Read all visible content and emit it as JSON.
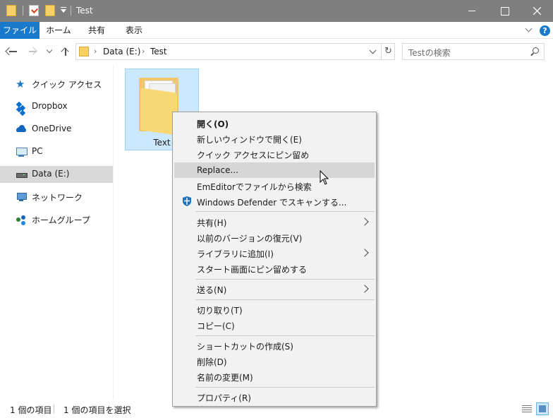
{
  "window": {
    "title": "Test"
  },
  "ribbon": {
    "tabs": [
      "ファイル",
      "ホーム",
      "共有",
      "表示"
    ]
  },
  "address": {
    "segments": [
      "Data (E:)",
      "Test"
    ],
    "search_placeholder": "Testの検索"
  },
  "navpane": {
    "items": [
      {
        "label": "クイック アクセス",
        "icon": "star-icon",
        "selected": false
      },
      {
        "label": "Dropbox",
        "icon": "dropbox-icon",
        "selected": false
      },
      {
        "label": "OneDrive",
        "icon": "onedrive-icon",
        "selected": false
      },
      {
        "label": "PC",
        "icon": "pc-icon",
        "selected": false
      },
      {
        "label": "Data (E:)",
        "icon": "drive-icon",
        "selected": true
      },
      {
        "label": "ネットワーク",
        "icon": "network-icon",
        "selected": false
      },
      {
        "label": "ホームグループ",
        "icon": "homegroup-icon",
        "selected": false
      }
    ]
  },
  "content": {
    "items": [
      {
        "label": "Text",
        "type": "folder",
        "selected": true
      }
    ]
  },
  "context_menu": {
    "items": [
      {
        "label": "開く(O)",
        "bold": true
      },
      {
        "label": "新しいウィンドウで開く(E)"
      },
      {
        "label": "クイック アクセスにピン留め"
      },
      {
        "label": "Replace...",
        "highlighted": true
      },
      {
        "label": "EmEditorでファイルから検索"
      },
      {
        "label": "Windows Defender でスキャンする...",
        "icon": "shield-icon"
      },
      {
        "label": "共有(H)",
        "submenu": true
      },
      {
        "label": "以前のバージョンの復元(V)"
      },
      {
        "label": "ライブラリに追加(I)",
        "submenu": true
      },
      {
        "label": "スタート画面にピン留めする"
      },
      {
        "label": "送る(N)",
        "submenu": true
      },
      {
        "label": "切り取り(T)"
      },
      {
        "label": "コピー(C)"
      },
      {
        "label": "ショートカットの作成(S)"
      },
      {
        "label": "削除(D)"
      },
      {
        "label": "名前の変更(M)"
      },
      {
        "label": "プロパティ(R)"
      }
    ]
  },
  "statusbar": {
    "item_count": "1 個の項目",
    "selected_count": "1 個の項目を選択"
  },
  "colors": {
    "accent": "#1979ca",
    "titlebar": "#7f7f7f",
    "selection": "#cce8ff",
    "menu_bg": "#f2f2f2",
    "menu_highlight": "#d6d6d6"
  }
}
